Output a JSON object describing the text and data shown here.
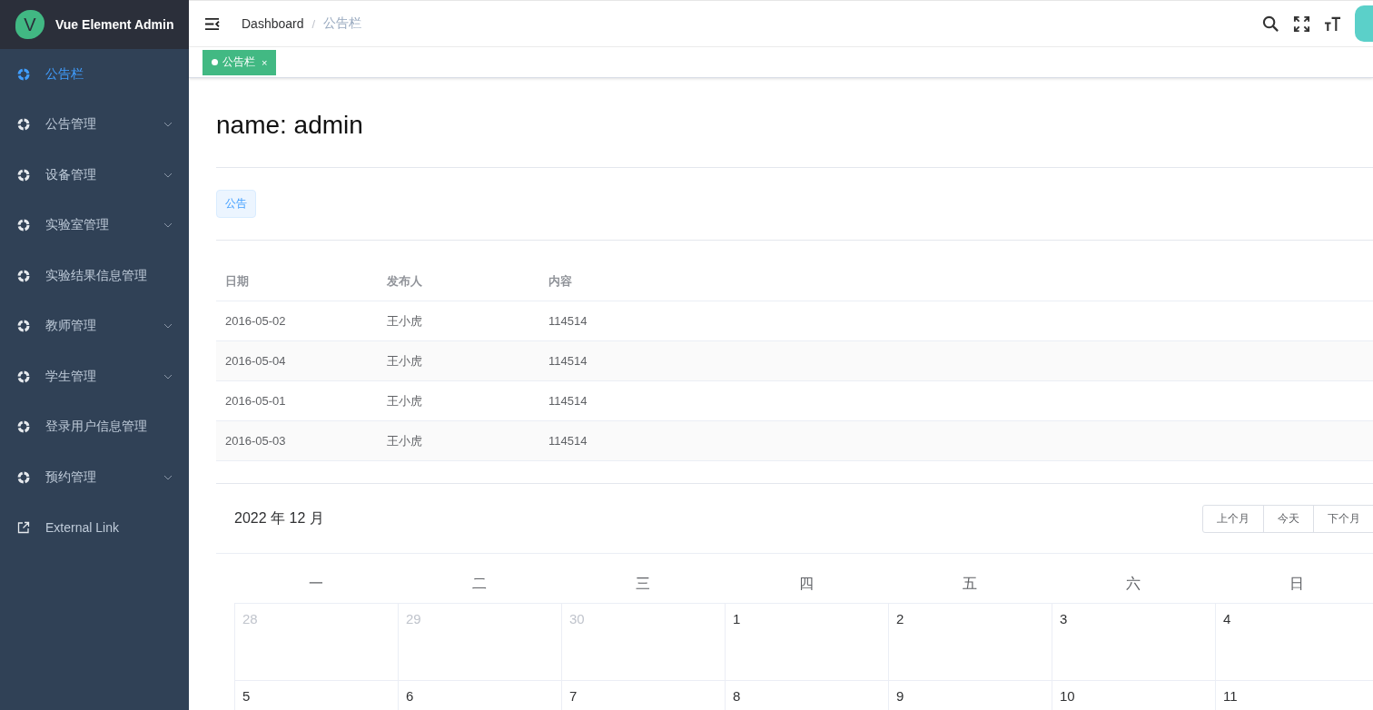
{
  "logo": {
    "letter": "V",
    "title": "Vue Element Admin"
  },
  "sidebar": {
    "items": [
      {
        "label": "公告栏",
        "kind": "circle",
        "selected": true,
        "has_children": false
      },
      {
        "label": "公告管理",
        "kind": "circle",
        "selected": false,
        "has_children": true
      },
      {
        "label": "设备管理",
        "kind": "circle",
        "selected": false,
        "has_children": true
      },
      {
        "label": "实验室管理",
        "kind": "circle",
        "selected": false,
        "has_children": true
      },
      {
        "label": "实验结果信息管理",
        "kind": "circle",
        "selected": false,
        "has_children": false
      },
      {
        "label": "教师管理",
        "kind": "circle",
        "selected": false,
        "has_children": true
      },
      {
        "label": "学生管理",
        "kind": "circle",
        "selected": false,
        "has_children": true
      },
      {
        "label": "登录用户信息管理",
        "kind": "circle",
        "selected": false,
        "has_children": false
      },
      {
        "label": "预约管理",
        "kind": "circle",
        "selected": false,
        "has_children": true
      },
      {
        "label": "External Link",
        "kind": "link",
        "selected": false,
        "has_children": false
      }
    ]
  },
  "breadcrumb": {
    "items": [
      "Dashboard",
      "公告栏"
    ],
    "separator": "/"
  },
  "tags": [
    {
      "label": "公告栏",
      "selected": true,
      "close": "×"
    }
  ],
  "heading": "name: admin",
  "badge": "公告",
  "table": {
    "columns": [
      "日期",
      "发布人",
      "内容"
    ],
    "rows": [
      {
        "cells": [
          "2016-05-02",
          "王小虎",
          "114514"
        ]
      },
      {
        "cells": [
          "2016-05-04",
          "王小虎",
          "114514"
        ]
      },
      {
        "cells": [
          "2016-05-01",
          "王小虎",
          "114514"
        ]
      },
      {
        "cells": [
          "2016-05-03",
          "王小虎",
          "114514"
        ]
      }
    ]
  },
  "calendar": {
    "title": "2022 年 12 月",
    "buttons": [
      "上个月",
      "今天",
      "下个月"
    ],
    "weekdays": [
      "一",
      "二",
      "三",
      "四",
      "五",
      "六",
      "日"
    ],
    "weeks": [
      [
        {
          "day": "28",
          "kind": "prev"
        },
        {
          "day": "29",
          "kind": "prev"
        },
        {
          "day": "30",
          "kind": "prev"
        },
        {
          "day": "1",
          "kind": "current"
        },
        {
          "day": "2",
          "kind": "current"
        },
        {
          "day": "3",
          "kind": "current"
        },
        {
          "day": "4",
          "kind": "current"
        }
      ],
      [
        {
          "day": "5",
          "kind": "current"
        },
        {
          "day": "6",
          "kind": "current"
        },
        {
          "day": "7",
          "kind": "current"
        },
        {
          "day": "8",
          "kind": "current"
        },
        {
          "day": "9",
          "kind": "current"
        },
        {
          "day": "10",
          "kind": "current"
        },
        {
          "day": "11",
          "kind": "current"
        }
      ]
    ]
  }
}
